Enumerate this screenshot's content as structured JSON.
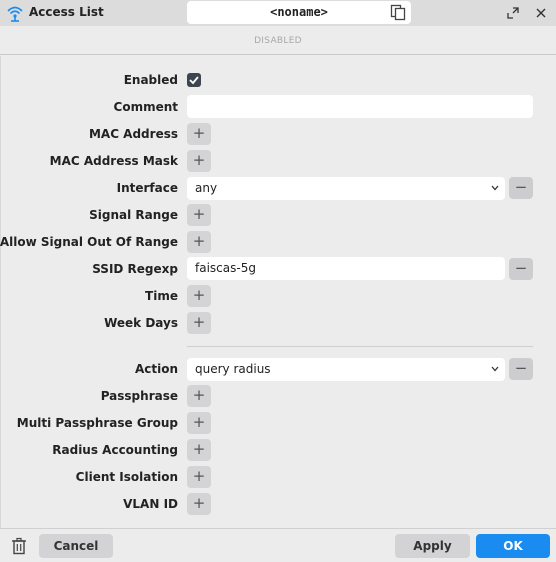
{
  "window": {
    "title": "Access List",
    "name": "<noname>",
    "status": "DISABLED"
  },
  "form": {
    "enabled_label": "Enabled",
    "enabled_checked": true,
    "comment_label": "Comment",
    "comment_value": "",
    "mac_address_label": "MAC Address",
    "mac_address_mask_label": "MAC Address Mask",
    "interface_label": "Interface",
    "interface_value": "any",
    "signal_range_label": "Signal Range",
    "allow_signal_label": "Allow Signal Out Of Range",
    "ssid_regexp_label": "SSID Regexp",
    "ssid_regexp_value": "faiscas-5g",
    "time_label": "Time",
    "week_days_label": "Week Days",
    "action_label": "Action",
    "action_value": "query radius",
    "passphrase_label": "Passphrase",
    "multi_passphrase_label": "Multi Passphrase Group",
    "radius_accounting_label": "Radius Accounting",
    "client_isolation_label": "Client Isolation",
    "vlan_id_label": "VLAN ID",
    "add_symbol": "+",
    "remove_symbol": "−"
  },
  "footer": {
    "cancel_label": "Cancel",
    "apply_label": "Apply",
    "ok_label": "OK"
  },
  "colors": {
    "accent": "#1a8cf0",
    "title_icon": "#1a8cf0",
    "checkbox": "#3d4550"
  },
  "icons": [
    "wireless-icon",
    "copy-icon",
    "restore-icon",
    "close-icon",
    "chevron-down-icon",
    "check-icon",
    "trash-icon"
  ]
}
